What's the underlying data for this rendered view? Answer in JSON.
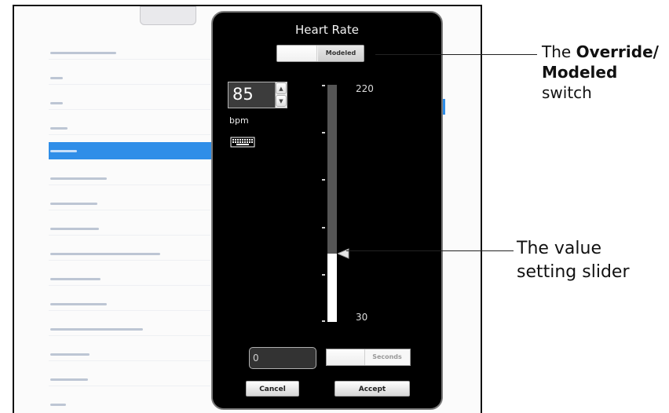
{
  "dialog": {
    "title": "Heart Rate",
    "mode_toggle_label": "Modeled",
    "value": "85",
    "unit": "bpm",
    "scale_max": "220",
    "scale_min": "30",
    "slider_value": 85,
    "slider_range": [
      30,
      220
    ],
    "duration_value": "0",
    "duration_unit_toggle_label": "Seconds",
    "cancel_label": "Cancel",
    "accept_label": "Accept"
  },
  "annotations": {
    "switch_callout_prefix": "The ",
    "switch_callout_bold_1": "Override/",
    "switch_callout_bold_2": "Modeled",
    "switch_callout_suffix": "switch",
    "slider_callout_line1": "The value",
    "slider_callout_line2": "setting slider"
  },
  "colors": {
    "dialog_bg": "#000000",
    "selection": "#2f8ee8",
    "track": "#555555",
    "fill": "#ffffff"
  },
  "icons": [
    "keyboard-icon",
    "stepper-up-icon",
    "stepper-down-icon",
    "slider-thumb-icon"
  ]
}
